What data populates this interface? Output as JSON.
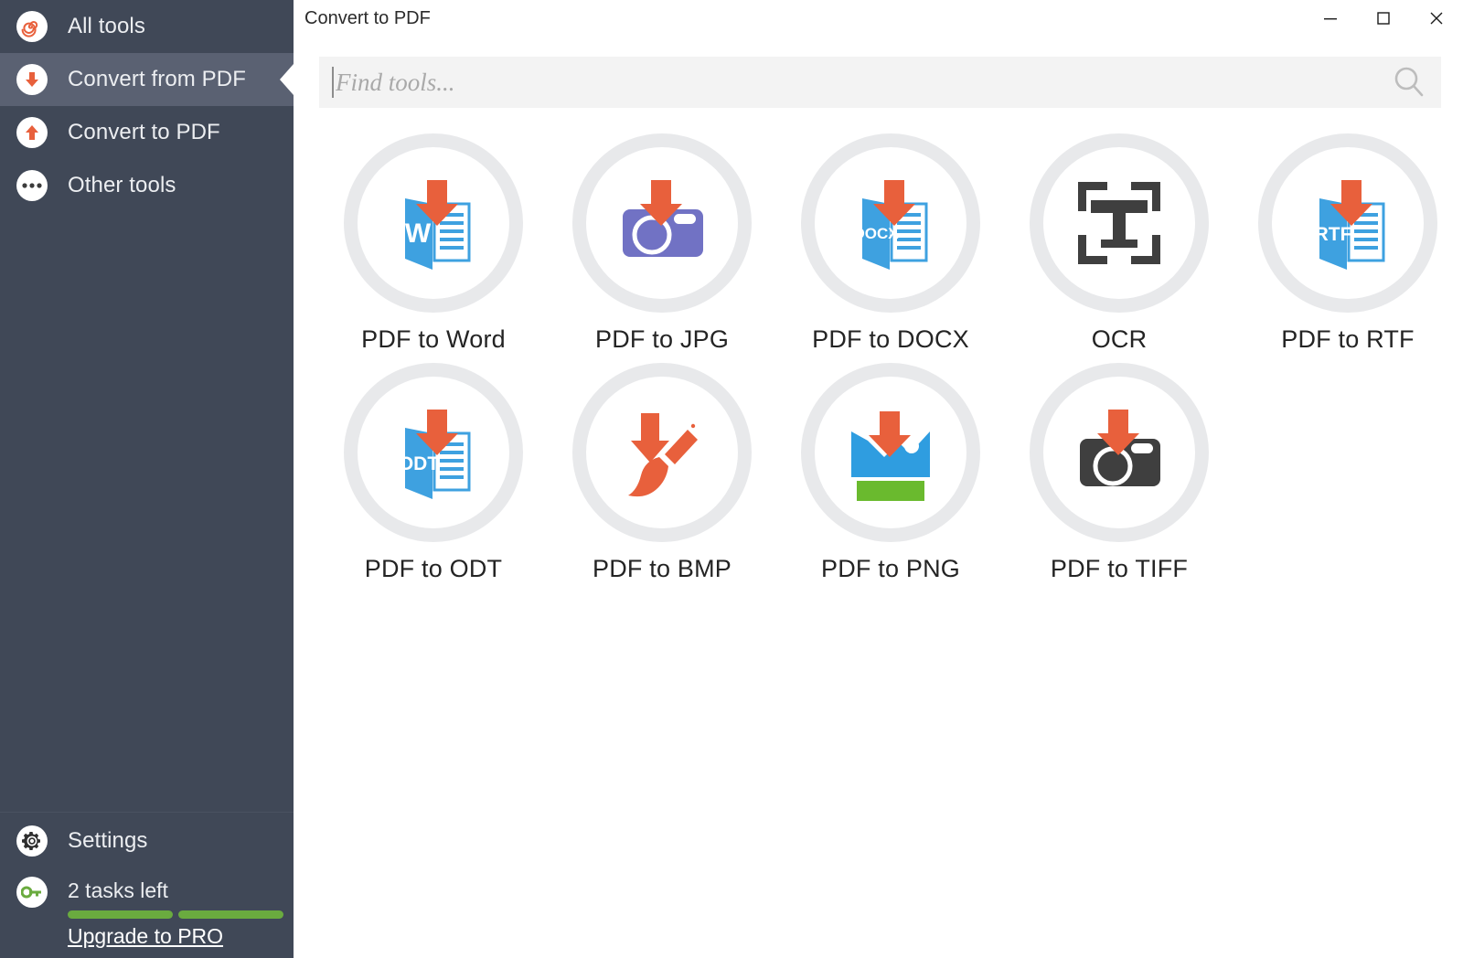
{
  "window": {
    "title": "Convert to PDF",
    "controls": [
      {
        "name": "minimize-button",
        "glyph": "minimize"
      },
      {
        "name": "maximize-button",
        "glyph": "maximize"
      },
      {
        "name": "close-button",
        "glyph": "close"
      }
    ]
  },
  "search": {
    "value": "",
    "placeholder": "Find tools...",
    "icon": "search-icon"
  },
  "sidebar": {
    "items": [
      {
        "label": "All tools",
        "icon": "spiral-icon",
        "active": false
      },
      {
        "label": "Convert from PDF",
        "icon": "arrow-down-icon",
        "active": true
      },
      {
        "label": "Convert to PDF",
        "icon": "arrow-up-icon",
        "active": false
      },
      {
        "label": "Other tools",
        "icon": "ellipsis-icon",
        "active": false
      }
    ],
    "settings": {
      "label": "Settings",
      "icon": "gear-icon"
    },
    "tasks": {
      "label": "2 tasks left",
      "icon": "key-icon",
      "segments": 2,
      "upgrade_label": "Upgrade to PRO"
    }
  },
  "tools": [
    {
      "label": "PDF to Word",
      "icon": "pdf-to-word-icon"
    },
    {
      "label": "PDF to JPG",
      "icon": "pdf-to-jpg-icon"
    },
    {
      "label": "PDF to DOCX",
      "icon": "pdf-to-docx-icon"
    },
    {
      "label": "OCR",
      "icon": "ocr-icon"
    },
    {
      "label": "PDF to RTF",
      "icon": "pdf-to-rtf-icon"
    },
    {
      "label": "PDF to ODT",
      "icon": "pdf-to-odt-icon"
    },
    {
      "label": "PDF to BMP",
      "icon": "pdf-to-bmp-icon"
    },
    {
      "label": "PDF to PNG",
      "icon": "pdf-to-png-icon"
    },
    {
      "label": "PDF to TIFF",
      "icon": "pdf-to-tiff-icon"
    }
  ],
  "doc_badges": {
    "word": "W",
    "docx": "DOCX",
    "rtf": "RTF",
    "odt": "ODT",
    "ocr": "T"
  },
  "colors": {
    "sidebar_bg": "#404857",
    "sidebar_active": "#5a6172",
    "accent_orange": "#e8603c",
    "doc_blue": "#3ea1e0",
    "camera_purple": "#7172c4",
    "progress_green": "#6aab3f",
    "ring_gray": "#e8e9eb",
    "ocr_dark": "#3f3f3f"
  }
}
